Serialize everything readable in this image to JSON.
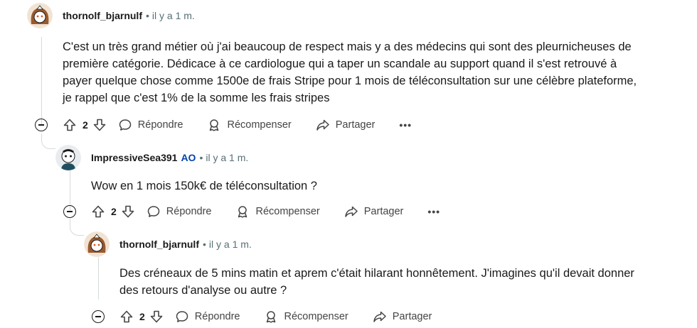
{
  "comments": [
    {
      "username": "thornolf_bjarnulf",
      "op_tag": "",
      "separator": "•",
      "time": "il y a 1 m.",
      "body": [
        "C'est un très grand métier où j'ai beaucoup de respect mais y a des médecins qui sont des pleurnicheuses de",
        "première catégorie. Dédicace à ce cardiologue qui a taper un scandale au support quand il s'est retrouvé à",
        "payer quelque chose comme 1500e de frais Stripe pour 1 mois de téléconsultation sur une célèbre plateforme,",
        "je rappel que c'est 1% de la somme les frais stripes"
      ],
      "votes": "2",
      "reply_label": "Répondre",
      "award_label": "Récompenser",
      "share_label": "Partager",
      "more_label": "•••"
    },
    {
      "username": "ImpressiveSea391",
      "op_tag": "AO",
      "separator": "•",
      "time": "il y a 1 m.",
      "body": [
        "Wow en 1 mois 150k€ de téléconsultation ?"
      ],
      "votes": "2",
      "reply_label": "Répondre",
      "award_label": "Récompenser",
      "share_label": "Partager",
      "more_label": "•••"
    },
    {
      "username": "thornolf_bjarnulf",
      "op_tag": "",
      "separator": "•",
      "time": "il y a 1 m.",
      "body": [
        "Des créneaux de 5 mins matin et aprem c'était hilarant honnêtement. J'imagines qu'il devait donner",
        "des retours d'analyse ou autre ?"
      ],
      "votes": "2",
      "reply_label": "Répondre",
      "award_label": "Récompenser",
      "share_label": "Partager",
      "more_label": "•••"
    }
  ],
  "icons": {
    "collapse": "collapse-icon",
    "upvote": "upvote-icon",
    "downvote": "downvote-icon",
    "reply": "reply-icon",
    "award": "award-icon",
    "share": "share-icon",
    "more": "more-icon"
  },
  "colors": {
    "op_tag": "#0045ac",
    "meta_text": "#576f76",
    "thread_line": "#d6dadc"
  }
}
